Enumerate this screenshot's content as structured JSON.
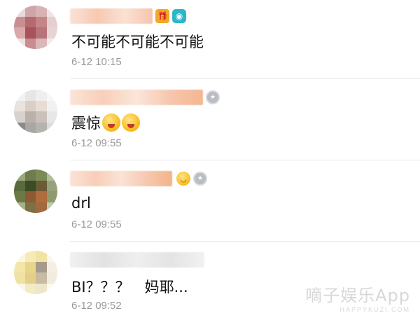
{
  "comments": [
    {
      "text": "不可能不可能不可能",
      "time": "6-12 10:15",
      "badges": [
        "gift-badge-icon",
        "camera-badge-icon"
      ]
    },
    {
      "text": "震惊",
      "time": "6-12 09:55",
      "badges": [
        "medal-badge-icon"
      ],
      "emojis": [
        "heart-eyes-emoji",
        "heart-eyes-emoji"
      ]
    },
    {
      "text": "drl",
      "time": "6-12 09:55",
      "badges": [
        "grin-emoji-icon",
        "medal-badge-icon"
      ]
    },
    {
      "text": "BI？？？　妈耶...",
      "time": "6-12 09:52",
      "badges": []
    }
  ],
  "watermark": {
    "main": "嘀子娱乐App",
    "sub": "HAPPYKUZI.COM"
  },
  "colors": {
    "text": "#111111",
    "time": "#9a9a9a",
    "divider": "#e9e9e9",
    "name_blur": "#f6c3a9"
  }
}
